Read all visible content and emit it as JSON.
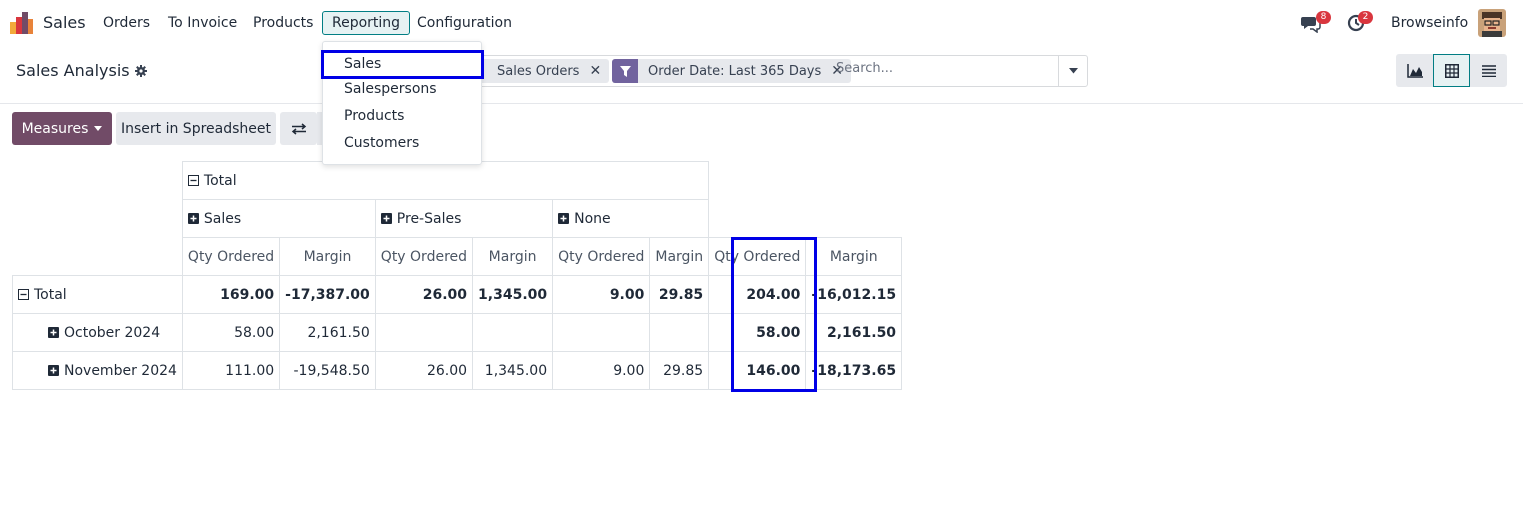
{
  "nav": {
    "app_name": "Sales",
    "menu": [
      "Orders",
      "To Invoice",
      "Products",
      "Reporting",
      "Configuration"
    ],
    "active_menu": "Reporting",
    "messages_count": "8",
    "activities_count": "2",
    "company": "Browseinfo"
  },
  "control_panel": {
    "title": "Sales Analysis",
    "facets": [
      "Sales Orders",
      "Order Date: Last 365 Days"
    ],
    "search_placeholder": "Search..."
  },
  "reporting_menu": {
    "items": [
      "Sales",
      "Salespersons",
      "Products",
      "Customers"
    ],
    "highlighted": "Sales"
  },
  "toolbar": {
    "measures_label": "Measures",
    "insert_label": "Insert in Spreadsheet"
  },
  "pivot": {
    "col_total": "Total",
    "col_groups": [
      "Sales",
      "Pre-Sales",
      "None"
    ],
    "measures": [
      "Qty Ordered",
      "Margin",
      "Qty Ordered",
      "Margin",
      "Qty Ordered",
      "Margin",
      "Qty Ordered",
      "Margin"
    ],
    "rows": [
      {
        "label": "Total",
        "values": [
          "169.00",
          "-17,387.00",
          "26.00",
          "1,345.00",
          "9.00",
          "29.85",
          "204.00",
          "-16,012.15"
        ]
      },
      {
        "label": "October 2024",
        "values": [
          "58.00",
          "2,161.50",
          "",
          "",
          "",
          "",
          "58.00",
          "2,161.50"
        ]
      },
      {
        "label": "November 2024",
        "values": [
          "111.00",
          "-19,548.50",
          "26.00",
          "1,345.00",
          "9.00",
          "29.85",
          "146.00",
          "-18,173.65"
        ]
      }
    ]
  },
  "colors": {
    "brand": "#714b67",
    "accent": "#017e84",
    "highlight": "#0000e6",
    "badge": "#d9363e"
  }
}
